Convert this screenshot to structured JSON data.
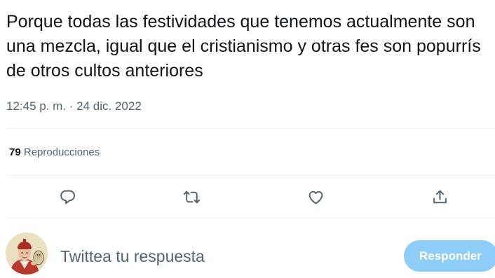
{
  "tweet": {
    "text": "Porque todas las festividades que tenemos actualmente son una mezcla, igual que el cristianismo y otras fes son popurrís de otros cultos anteriores",
    "timestamp": "12:45 p. m. · 24 dic. 2022"
  },
  "stats": {
    "views_count": "79",
    "views_label": "Reproducciones"
  },
  "actions": [
    {
      "name": "reply",
      "icon": "reply-icon"
    },
    {
      "name": "retweet",
      "icon": "retweet-icon"
    },
    {
      "name": "like",
      "icon": "heart-icon"
    },
    {
      "name": "share",
      "icon": "share-icon"
    }
  ],
  "reply_box": {
    "placeholder": "Twittea tu respuesta",
    "value": "",
    "button_label": "Responder"
  },
  "colors": {
    "text_primary": "#0f1419",
    "text_secondary": "#536471",
    "divider": "#eff3f4",
    "button_disabled": "#8ecdf8"
  }
}
